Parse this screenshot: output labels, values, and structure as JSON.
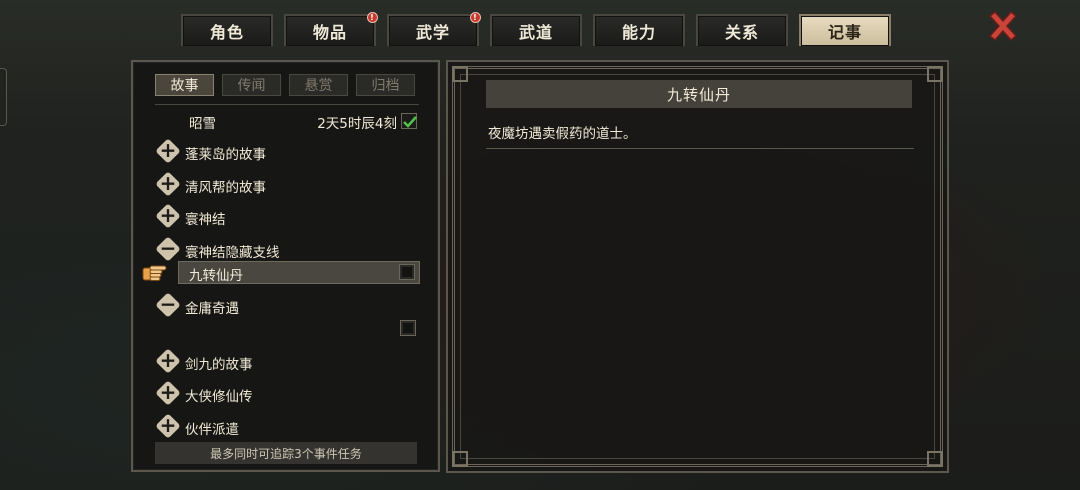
{
  "tabs": [
    {
      "label": "角色",
      "badge": false
    },
    {
      "label": "物品",
      "badge": true
    },
    {
      "label": "武学",
      "badge": true
    },
    {
      "label": "武道",
      "badge": false
    },
    {
      "label": "能力",
      "badge": false
    },
    {
      "label": "关系",
      "badge": false
    },
    {
      "label": "记事",
      "badge": false,
      "active": true
    }
  ],
  "badge_glyph": "!",
  "subtabs": [
    "故事",
    "传闻",
    "悬赏",
    "归档"
  ],
  "tracked": {
    "name": "昭雪",
    "time": "2天5时辰4刻",
    "checked": true
  },
  "quests": [
    {
      "label": "蓬莱岛的故事",
      "expanded": false
    },
    {
      "label": "清风帮的故事",
      "expanded": false
    },
    {
      "label": "寰神结",
      "expanded": false
    },
    {
      "label": "寰神结隐藏支线",
      "expanded": true
    },
    {
      "label": "金庸奇遇",
      "expanded": true
    },
    {
      "label": "剑九的故事",
      "expanded": false
    },
    {
      "label": "大侠修仙传",
      "expanded": false
    },
    {
      "label": "伙伴派遣",
      "expanded": false
    }
  ],
  "selected_quest": {
    "label": "九转仙丹",
    "checked": false
  },
  "footer_note": "最多同时可追踪3个事件任务",
  "detail": {
    "title": "九转仙丹",
    "description": "夜魔坊遇卖假药的道士。"
  },
  "glyphs": {
    "plus": "+",
    "minus": "−"
  },
  "icons": {
    "close": "close-x-icon",
    "pointer": "pointing-hand-icon",
    "check": "checkmark-icon"
  },
  "colors": {
    "accent_active_tab": "#e8dcc0",
    "badge": "#c83a2e",
    "check": "#4fbf4a",
    "close": "#c9453a"
  }
}
